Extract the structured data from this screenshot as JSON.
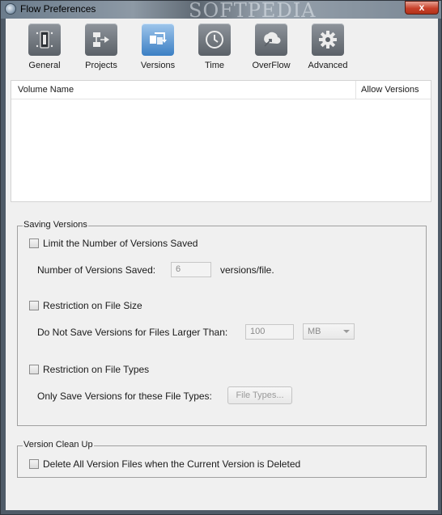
{
  "window": {
    "title": "Flow Preferences",
    "watermark": "SOFTPEDIA",
    "close_label": "x"
  },
  "toolbar": {
    "items": [
      {
        "label": "General",
        "icon": "general-icon",
        "active": false
      },
      {
        "label": "Projects",
        "icon": "projects-icon",
        "active": false
      },
      {
        "label": "Versions",
        "icon": "versions-icon",
        "active": true
      },
      {
        "label": "Time",
        "icon": "clock-icon",
        "active": false
      },
      {
        "label": "OverFlow",
        "icon": "overflow-icon",
        "active": false
      },
      {
        "label": "Advanced",
        "icon": "gear-icon",
        "active": false
      }
    ]
  },
  "volume_table": {
    "columns": [
      "Volume Name",
      "Allow Versions"
    ],
    "rows": []
  },
  "saving_versions": {
    "title": "Saving Versions",
    "limit_checkbox": {
      "label": "Limit the Number of Versions Saved",
      "checked": false
    },
    "num_label": "Number of Versions Saved:",
    "num_value": "6",
    "num_suffix": "versions/file.",
    "size_checkbox": {
      "label": "Restriction on File Size",
      "checked": false
    },
    "size_label": "Do Not Save Versions for Files Larger Than:",
    "size_value": "100",
    "size_unit": "MB",
    "types_checkbox": {
      "label": "Restriction on File Types",
      "checked": false
    },
    "types_label": "Only Save Versions for these File Types:",
    "types_button": "File Types..."
  },
  "cleanup": {
    "title": "Version Clean Up",
    "delete_checkbox": {
      "label": "Delete All Version Files when the Current Version is Deleted",
      "checked": false
    }
  }
}
